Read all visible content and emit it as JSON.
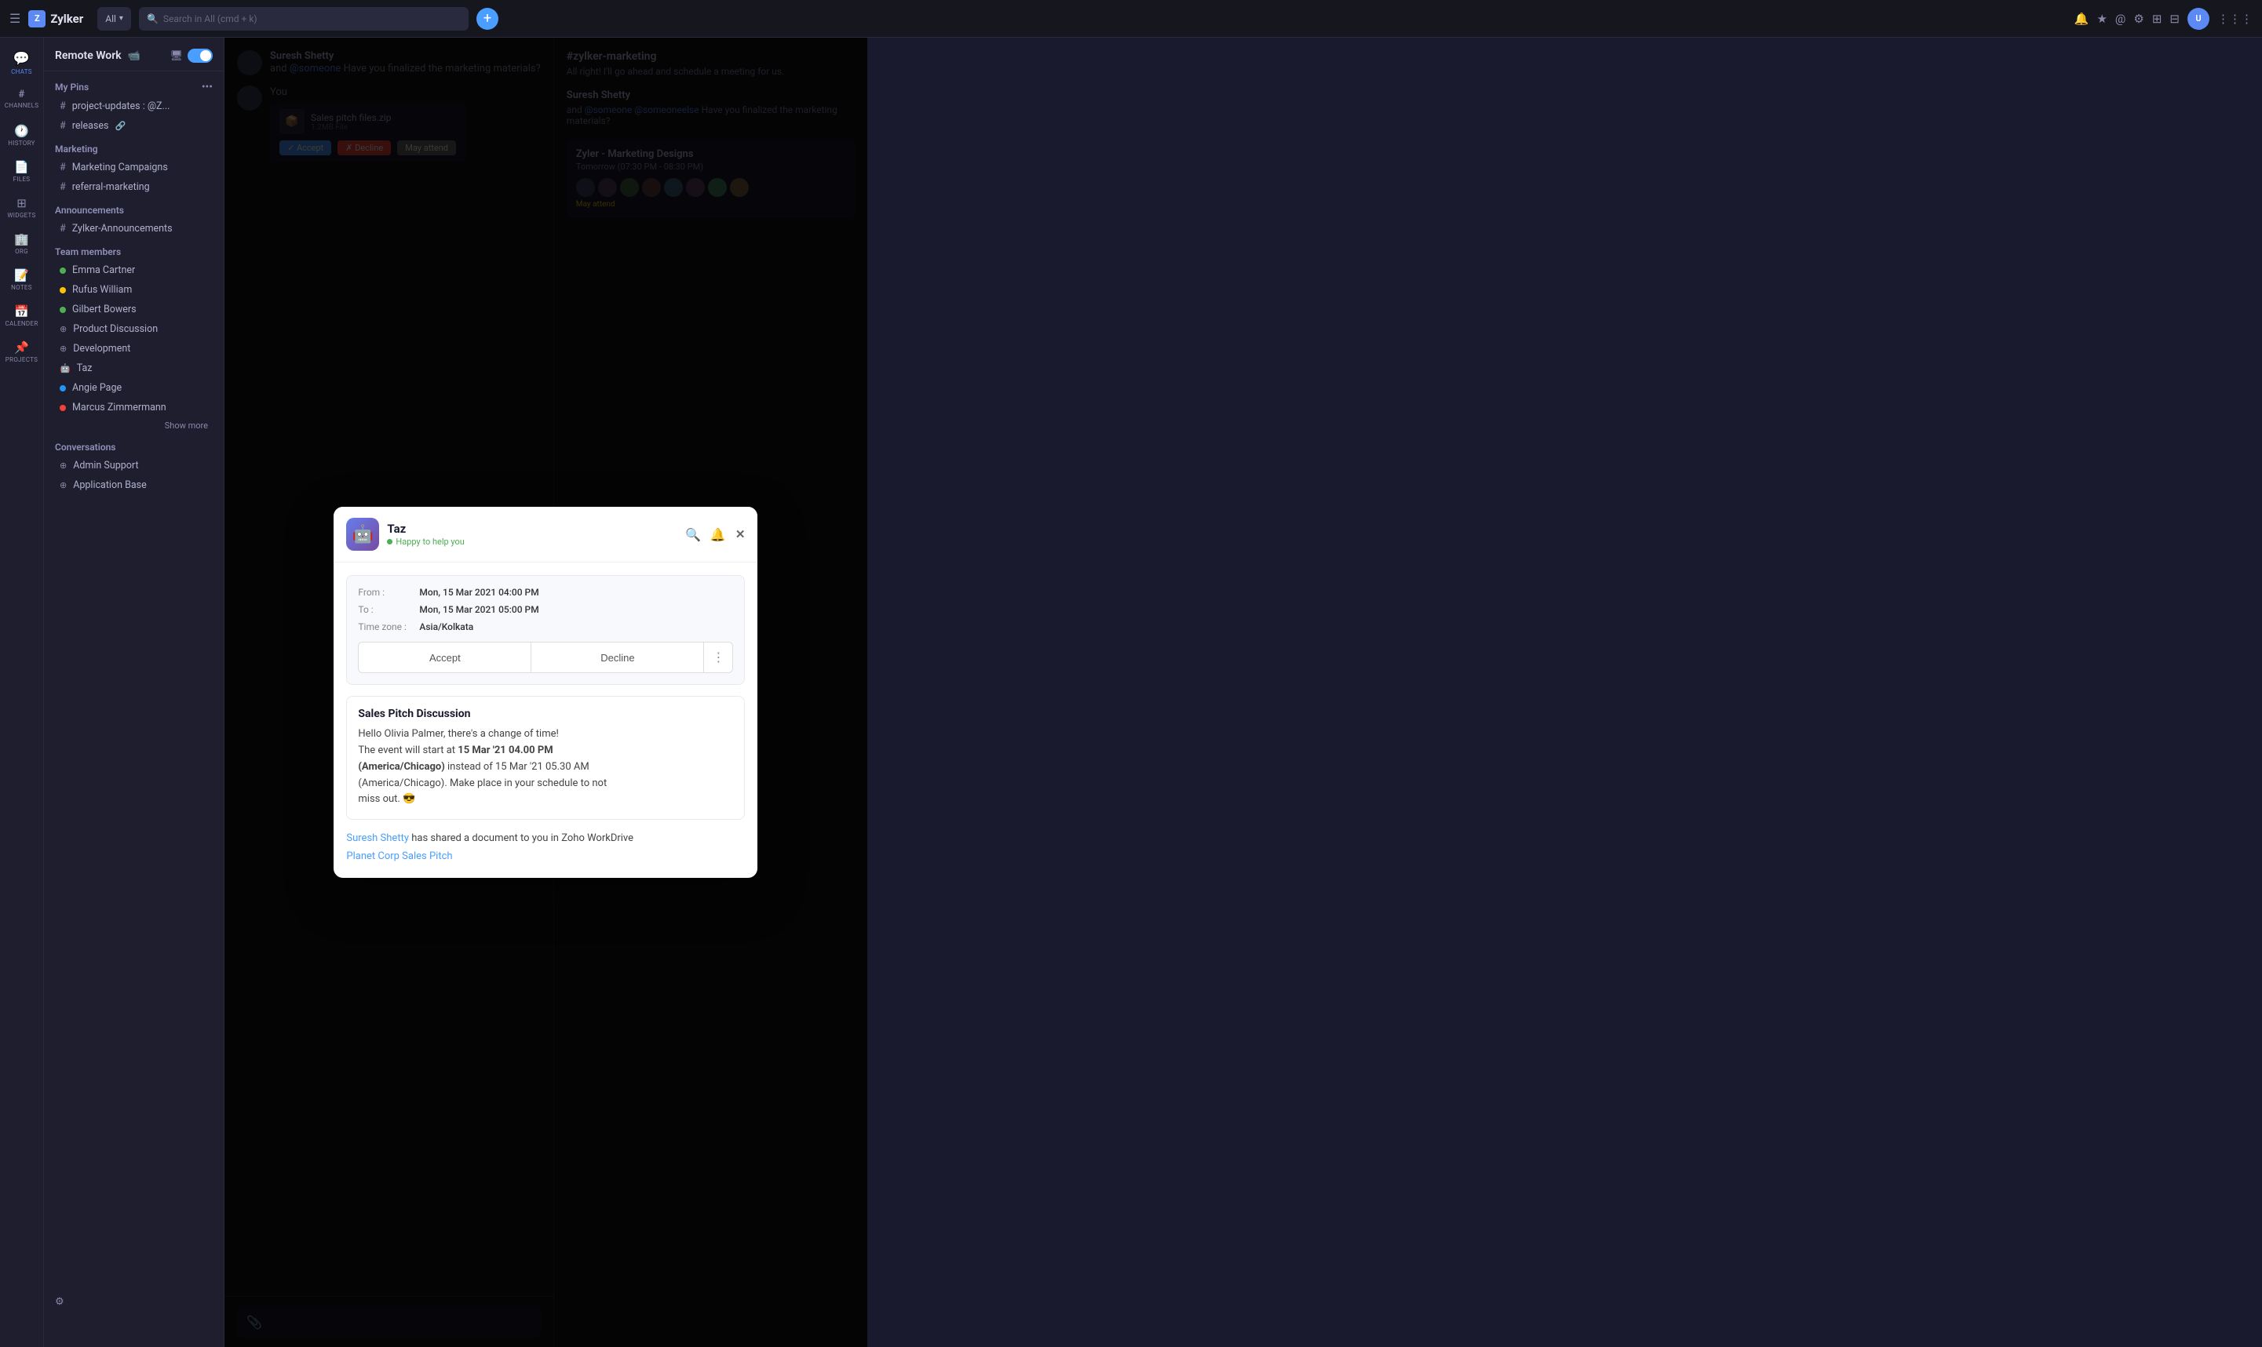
{
  "app": {
    "name": "Zylker",
    "logo_letter": "Z"
  },
  "topbar": {
    "hamburger": "☰",
    "search_placeholder": "Search in All (cmd + k)",
    "search_filter": "All",
    "add_btn": "+",
    "icons": [
      "🔔",
      "★",
      "@",
      "⚙",
      "⊞",
      "⊟"
    ]
  },
  "sidebar": {
    "workspace": "Remote Work",
    "sections": {
      "chats_label": "CHATS",
      "channels_label": "CHANNELS",
      "my_pins_label": "My Pins"
    },
    "pins": [
      {
        "name": "project-updates : @Z...",
        "type": "channel"
      },
      {
        "name": "releases",
        "type": "channel"
      }
    ],
    "groups": [
      {
        "name": "Marketing",
        "items": [
          {
            "name": "Marketing Campaigns",
            "type": "channel"
          },
          {
            "name": "referral-marketing",
            "type": "channel"
          }
        ]
      },
      {
        "name": "Announcements",
        "items": [
          {
            "name": "Zylker-Announcements",
            "type": "channel"
          }
        ]
      },
      {
        "name": "Team members",
        "items": [
          {
            "name": "Emma Cartner",
            "dot": "green"
          },
          {
            "name": "Rufus William",
            "dot": "yellow"
          },
          {
            "name": "Gilbert Bowers",
            "dot": "green"
          },
          {
            "name": "Product Discussion",
            "dot": "gray",
            "type": "group"
          },
          {
            "name": "Development",
            "dot": "gray",
            "type": "group"
          },
          {
            "name": "Taz",
            "dot": "gray",
            "type": "bot"
          },
          {
            "name": "Angie Page",
            "dot": "blue"
          },
          {
            "name": "Marcus Zimmermann",
            "dot": "red"
          }
        ]
      }
    ],
    "show_more": "Show more",
    "conversations_label": "Conversations",
    "conversations": [
      {
        "name": "Admin Support",
        "type": "group"
      },
      {
        "name": "Application Base",
        "type": "group"
      }
    ],
    "footer_icon": "⚙"
  },
  "nav_rail": [
    {
      "icon": "💬",
      "label": "CHATS"
    },
    {
      "icon": "#",
      "label": "CHANNELS"
    },
    {
      "icon": "🕐",
      "label": "HISTORY"
    },
    {
      "icon": "📄",
      "label": "FILES"
    },
    {
      "icon": "⊞",
      "label": "WIDGETS"
    },
    {
      "icon": "🏢",
      "label": "ORG"
    },
    {
      "icon": "📝",
      "label": "NOTES"
    },
    {
      "icon": "📅",
      "label": "CALENDER"
    },
    {
      "icon": "📌",
      "label": "PROJECTS"
    }
  ],
  "right_panel": {
    "channel_name": "#zylker-marketing",
    "message_preview": "All right! I'll go ahead and schedule a meeting for us.",
    "sender1": "Suresh Shetty",
    "msg1_start": "and",
    "msg1_end": "Have you finalized the marketing materials?",
    "meeting_title": "Zyler - Marketing Designs",
    "meeting_time": "Tomorrow (07:30 PM - 08:30 PM)",
    "may_attend": "May attend"
  },
  "modal": {
    "bot_name": "Taz",
    "bot_status": "Happy to help you",
    "status_dot_color": "#4caf50",
    "invite_card": {
      "from_label": "From :",
      "from_value": "Mon, 15 Mar 2021 04:00 PM",
      "to_label": "To :",
      "to_value": "Mon, 15 Mar 2021 05:00 PM",
      "timezone_label": "Time zone :",
      "timezone_value": "Asia/Kolkata",
      "accept_label": "Accept",
      "decline_label": "Decline",
      "more_label": "⋮"
    },
    "sales_card": {
      "title": "Sales Pitch Discussion",
      "line1": "Hello Olivia Palmer, there's a change of time!",
      "line2_prefix": "The event will start at ",
      "line2_bold": "15 Mar '21 04.00 PM",
      "line3_prefix": "(America/Chicago)",
      "line3_suffix": " instead of 15 Mar '21 05.30 AM",
      "line4": "(America/Chicago). Make place in your schedule to not",
      "line5": "miss out. 😎"
    },
    "workdrive": {
      "sender_link": "Suresh Shetty",
      "message": "has shared a document to you in Zoho WorkDrive",
      "file_link": "Planet Corp Sales Pitch"
    },
    "close_icon": "✕",
    "bell_icon": "🔔",
    "search_icon": "🔍"
  },
  "chat_messages": [
    {
      "sender": "You",
      "text": "",
      "file_name": "Sales pitch files.zip",
      "file_size": "1.2MB File",
      "actions": [
        "✓ Accept",
        "✗ Decline",
        "May attend"
      ]
    }
  ]
}
